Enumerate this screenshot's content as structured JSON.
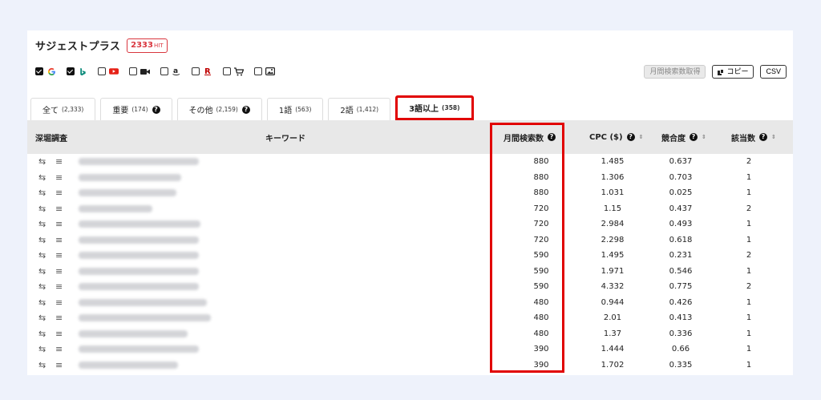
{
  "header": {
    "title": "サジェストプラス",
    "hit_count": "2333",
    "hit_suffix": "HIT"
  },
  "engines": [
    {
      "name": "google",
      "checked": true,
      "icon": "google-icon"
    },
    {
      "name": "bing",
      "checked": true,
      "icon": "bing-icon"
    },
    {
      "name": "youtube",
      "checked": false,
      "icon": "youtube-icon"
    },
    {
      "name": "video",
      "checked": false,
      "icon": "video-camera-icon"
    },
    {
      "name": "amazon",
      "checked": false,
      "icon": "amazon-icon"
    },
    {
      "name": "rakuten",
      "checked": false,
      "icon": "rakuten-icon"
    },
    {
      "name": "shopping",
      "checked": false,
      "icon": "shopping-cart-icon"
    },
    {
      "name": "image",
      "checked": false,
      "icon": "image-icon"
    }
  ],
  "actions": {
    "fetch_volume": "月間検索数取得",
    "copy": "コピー",
    "csv": "CSV"
  },
  "tabs": [
    {
      "label": "全て",
      "count": "(2,333)",
      "help": false
    },
    {
      "label": "重要",
      "count": "(174)",
      "help": true
    },
    {
      "label": "その他",
      "count": "(2,159)",
      "help": true
    },
    {
      "label": "1語",
      "count": "(563)",
      "help": false
    },
    {
      "label": "2語",
      "count": "(1,412)",
      "help": false
    },
    {
      "label": "3語以上",
      "count": "(358)",
      "help": false,
      "active": true
    }
  ],
  "columns": {
    "deep": "深堀調査",
    "keyword": "キーワード",
    "volume": "月間検索数",
    "cpc": "CPC ($)",
    "competition": "競合度",
    "matches": "該当数"
  },
  "rows": [
    {
      "volume": "880",
      "cpc": "1.485",
      "competition": "0.637",
      "matches": "2"
    },
    {
      "volume": "880",
      "cpc": "1.306",
      "competition": "0.703",
      "matches": "1"
    },
    {
      "volume": "880",
      "cpc": "1.031",
      "competition": "0.025",
      "matches": "1"
    },
    {
      "volume": "720",
      "cpc": "1.15",
      "competition": "0.437",
      "matches": "2"
    },
    {
      "volume": "720",
      "cpc": "2.984",
      "competition": "0.493",
      "matches": "1"
    },
    {
      "volume": "720",
      "cpc": "2.298",
      "competition": "0.618",
      "matches": "1"
    },
    {
      "volume": "590",
      "cpc": "1.495",
      "competition": "0.231",
      "matches": "2"
    },
    {
      "volume": "590",
      "cpc": "1.971",
      "competition": "0.546",
      "matches": "1"
    },
    {
      "volume": "590",
      "cpc": "4.332",
      "competition": "0.775",
      "matches": "2"
    },
    {
      "volume": "480",
      "cpc": "0.944",
      "competition": "0.426",
      "matches": "1"
    },
    {
      "volume": "480",
      "cpc": "2.01",
      "competition": "0.413",
      "matches": "1"
    },
    {
      "volume": "480",
      "cpc": "1.37",
      "competition": "0.336",
      "matches": "1"
    },
    {
      "volume": "390",
      "cpc": "1.444",
      "competition": "0.66",
      "matches": "1"
    },
    {
      "volume": "390",
      "cpc": "1.702",
      "competition": "0.335",
      "matches": "1"
    }
  ],
  "colors": {
    "accent_red": "#e10000",
    "badge_red": "#d9363e",
    "header_bg": "#e8e8e8",
    "page_bg": "#eef2fb"
  }
}
